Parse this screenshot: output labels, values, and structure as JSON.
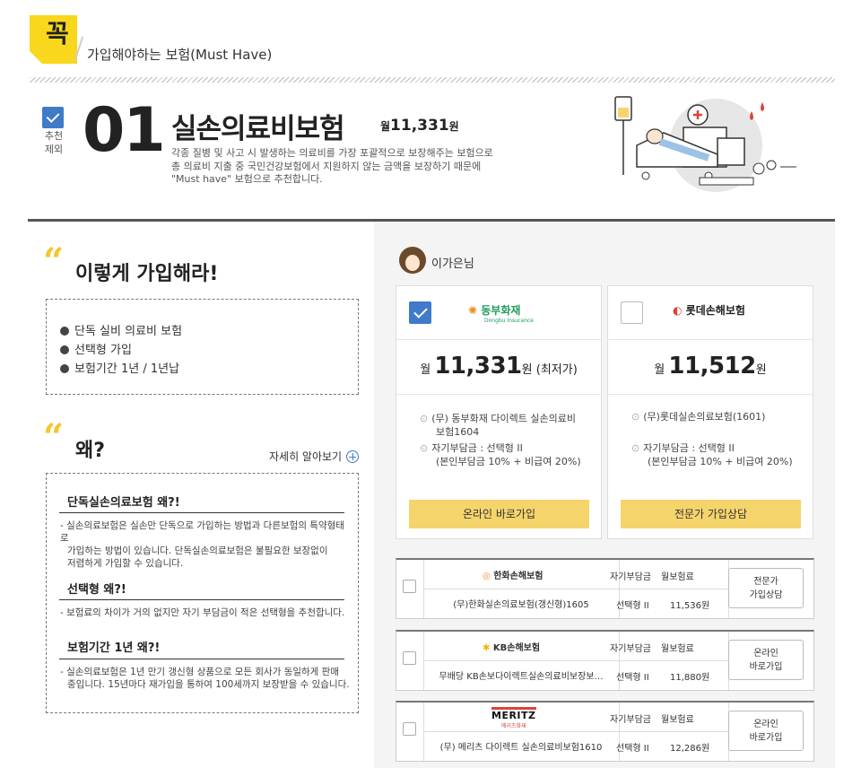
{
  "header": {
    "badge": "꼭",
    "title": "가입해야하는 보험(Must Have)"
  },
  "item": {
    "exclude_label": "추천 제외",
    "number": "01",
    "title": "실손의료비보험",
    "price_prefix": "월",
    "price": "11,331",
    "price_unit": "원",
    "desc_lines": [
      "각종 질병 및 사고 시 발생하는 의료비를 가장 포괄적으로 보장해주는 보험으로",
      "총 의료비 지출 중 국민건강보험에서 지원하지 않는 금액을 보장하기 때문에",
      "\"Must have\" 보험으로 추천합니다."
    ]
  },
  "how": {
    "title": "이렇게 가입해라!",
    "bullets": [
      "단독 실비 의료비 보험",
      "선택형 가입",
      "보험기간 1년 / 1년납"
    ]
  },
  "why": {
    "title": "왜?",
    "more_link": "자세히 알아보기",
    "sections": [
      {
        "heading": "단독실손의료보험 왜?!",
        "lines": [
          "- 실손의료보험은 실손만 단독으로 가입하는 방법과 다른보험의 특약형태로",
          "가입하는 방법이 있습니다. 단독실손의료보험은 불필요한 보장없이",
          "저렴하게 가입할 수 있습니다."
        ]
      },
      {
        "heading": "선택형 왜?!",
        "lines": [
          "- 보험료의 차이가 거의 없지만 자기 부담금이 적은 선택형을 추천합니다."
        ]
      },
      {
        "heading": "보험기간 1년 왜?!",
        "lines": [
          "- 실손의료보험은 1년 만기 갱신형 상품으로 모든 회사가 동일하게 판매",
          "중입니다. 15년마다 재가입을 통하여 100세까지 보장받을 수 있습니다."
        ]
      }
    ]
  },
  "user": {
    "name": "이가은님"
  },
  "cards": [
    {
      "checked": true,
      "company": "동부화재",
      "company_sub": "Dongbu Insurance",
      "price_prefix": "월",
      "price": "11,331",
      "price_suffix": "원 (최저가)",
      "features": [
        "(무) 동부화재 다이렉트 실손의료비",
        "보험1604",
        "자기부담금 : 선택형 II",
        "(본인부담금 10% + 비급여 20%)"
      ],
      "button": "온라인 바로가입"
    },
    {
      "checked": false,
      "company": "롯데손해보험",
      "price_prefix": "월",
      "price": "11,512",
      "price_suffix": "원",
      "features": [
        "(무)롯데실손의료보험(1601)",
        "자기부담금 : 선택형 II",
        "(본인부담금 10% + 비급여 20%)"
      ],
      "button": "전문가 가입상담"
    }
  ],
  "rows": [
    {
      "company": "한화손해보험",
      "product": "(무)한화실손의료보험(갱신형)1605",
      "h1": "자기부담금",
      "v1": "선택형 II",
      "h2": "월보험료",
      "v2": "11,536원",
      "button_l1": "전문가",
      "button_l2": "가입상담"
    },
    {
      "company": "KB손해보험",
      "product": "무배당 KB손보다이렉트실손의료비보장보…",
      "h1": "자기부담금",
      "v1": "선택형 II",
      "h2": "월보험료",
      "v2": "11,880원",
      "button_l1": "온라인",
      "button_l2": "바로가입"
    },
    {
      "company": "MERITZ",
      "company_sub": "메리츠화재",
      "product": "(무) 메리츠 다이렉트 실손의료비보험1610",
      "h1": "자기부담금",
      "v1": "선택형 II",
      "h2": "월보험료",
      "v2": "12,286원",
      "button_l1": "온라인",
      "button_l2": "바로가입"
    }
  ],
  "colors": {
    "accent_yellow": "#f9d71c",
    "button_yellow": "#f6d46c",
    "check_blue": "#3f7bc9",
    "quote_yellow": "#f5c62e"
  }
}
